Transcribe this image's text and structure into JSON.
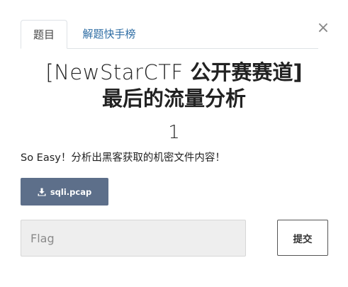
{
  "tabs": [
    {
      "label": "题目",
      "active": true
    },
    {
      "label": "解题快手榜",
      "active": false
    }
  ],
  "close_glyph": "×",
  "challenge": {
    "title_prefix": "[NewStarCTF ",
    "title_main": "公开赛赛道]",
    "title_sub": "最后的流量分析",
    "points": "1",
    "description": "So Easy！分析出黑客获取的机密文件内容！",
    "file_name": "sqli.pcap"
  },
  "form": {
    "flag_placeholder": "Flag",
    "submit_label": "提交"
  },
  "colors": {
    "file_button_bg": "#5d6f8a",
    "link_tab": "#2e6da4",
    "input_bg": "#eeeeee"
  },
  "icons": {
    "download": "download-icon",
    "close": "close-icon"
  }
}
